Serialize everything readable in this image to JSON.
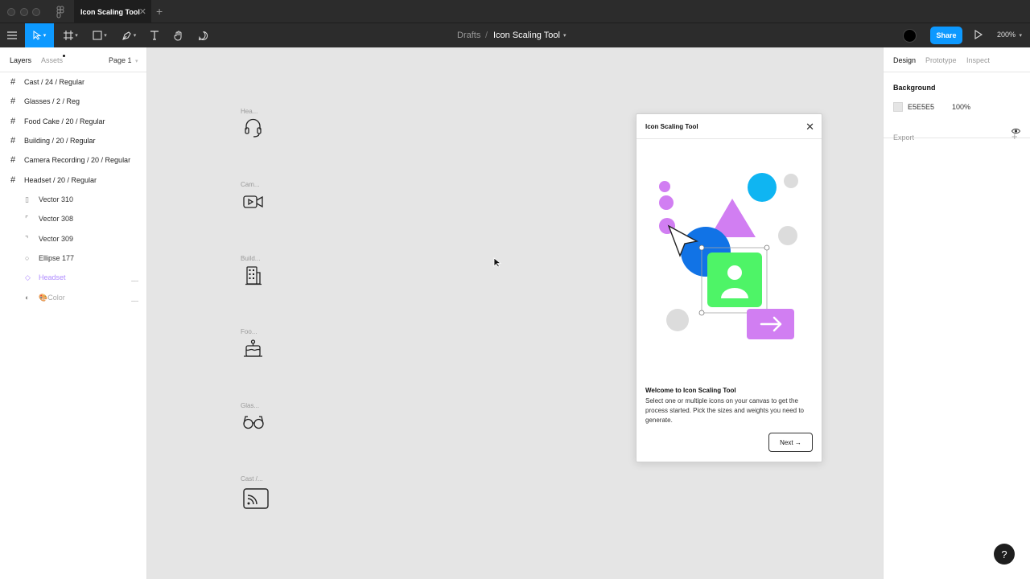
{
  "window": {
    "tab_title": "Icon Scaling Tool",
    "tab_close": "✕",
    "tab_add": "+"
  },
  "toolbar": {
    "breadcrumb_parent": "Drafts",
    "breadcrumb_sep": "/",
    "file_name": "Icon Scaling Tool",
    "share_label": "Share",
    "zoom": "200%"
  },
  "left_panel": {
    "tab_layers": "Layers",
    "tab_assets": "Assets",
    "page_selector": "Page 1",
    "layers": [
      {
        "label": "Cast / 24 / Regular",
        "icon": "frame-icon"
      },
      {
        "label": "Glasses / 2 / Reg",
        "icon": "frame-icon"
      },
      {
        "label": "Food Cake / 20 / Regular",
        "icon": "frame-icon"
      },
      {
        "label": "Building / 20 / Regular",
        "icon": "frame-icon"
      },
      {
        "label": "Camera Recording / 20 / Regular",
        "icon": "frame-icon"
      },
      {
        "label": "Headset / 20 / Regular",
        "icon": "frame-icon"
      },
      {
        "label": "Vector 310",
        "icon": "vector-icon"
      },
      {
        "label": "Vector 308",
        "icon": "vector-icon"
      },
      {
        "label": "Vector 309",
        "icon": "vector-icon"
      },
      {
        "label": "Ellipse 177",
        "icon": "ellipse-icon"
      },
      {
        "label": "Headset",
        "icon": "component-icon"
      },
      {
        "label": "Color",
        "icon": "mask-icon"
      }
    ]
  },
  "canvas": {
    "frames": [
      {
        "label": "Hea...",
        "icon": "headset-icon"
      },
      {
        "label": "Cam...",
        "icon": "camera-recording-icon"
      },
      {
        "label": "Build...",
        "icon": "building-icon"
      },
      {
        "label": "Foo...",
        "icon": "food-cake-icon"
      },
      {
        "label": "Glas...",
        "icon": "glasses-icon"
      },
      {
        "label": "Cast /...",
        "icon": "cast-icon"
      }
    ]
  },
  "plugin": {
    "title": "Icon Scaling Tool",
    "close": "✕",
    "welcome_title": "Welcome to Icon Scaling Tool",
    "welcome_body": "Select one or multiple icons on your canvas to get the process started. Pick the sizes and weights you need to generate.",
    "next_label": "Next →"
  },
  "right_panel": {
    "tab_design": "Design",
    "tab_prototype": "Prototype",
    "tab_inspect": "Inspect",
    "background_label": "Background",
    "background_hex": "E5E5E5",
    "background_opacity": "100%",
    "export_label": "Export",
    "export_add": "+"
  },
  "help_label": "?",
  "colors": {
    "accent": "#0d99ff",
    "canvas": "#e5e5e5",
    "toolbar": "#2c2c2c"
  }
}
